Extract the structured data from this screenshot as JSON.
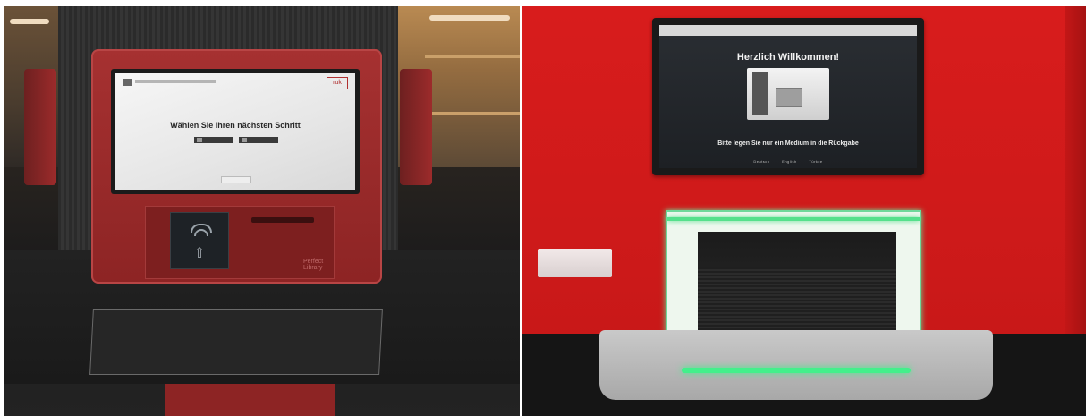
{
  "left_photo": {
    "screen": {
      "brand": "ruk",
      "title": "Wählen Sie Ihren nächsten Schritt",
      "buttons": [
        "Ausleihe",
        "Konto"
      ]
    },
    "kiosk_brand": "Perfect Library"
  },
  "right_photo": {
    "screen": {
      "title": "Herzlich Willkommen!",
      "subtitle": "Bitte legen Sie nur ein Medium in die Rückgabe",
      "footer_links": [
        "Deutsch",
        "English",
        "Türkçe"
      ]
    }
  },
  "colors": {
    "kiosk_red": "#8d2424",
    "wall_red": "#d81c1c",
    "glow_green": "#43f08b"
  }
}
